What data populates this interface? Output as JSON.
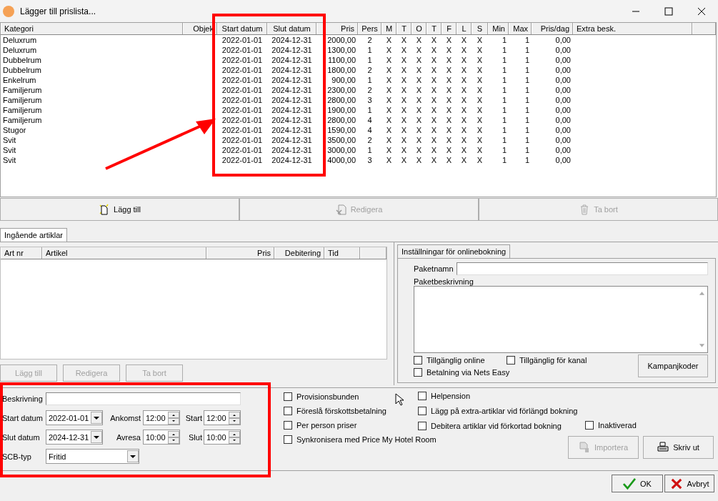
{
  "window": {
    "title": "Lägger till prislista..."
  },
  "price_table": {
    "columns": [
      "Kategori",
      "Objek",
      "Start datum",
      "Slut datum",
      "Pris",
      "Pers",
      "M",
      "T",
      "O",
      "T",
      "F",
      "L",
      "S",
      "Min",
      "Max",
      "Pris/dag",
      "Extra besk."
    ],
    "rows": [
      [
        "Deluxrum",
        "",
        "2022-01-01",
        "2024-12-31",
        "2000,00",
        "2",
        "X",
        "X",
        "X",
        "X",
        "X",
        "X",
        "X",
        "1",
        "1",
        "0,00",
        ""
      ],
      [
        "Deluxrum",
        "",
        "2022-01-01",
        "2024-12-31",
        "1300,00",
        "1",
        "X",
        "X",
        "X",
        "X",
        "X",
        "X",
        "X",
        "1",
        "1",
        "0,00",
        ""
      ],
      [
        "Dubbelrum",
        "",
        "2022-01-01",
        "2024-12-31",
        "1100,00",
        "1",
        "X",
        "X",
        "X",
        "X",
        "X",
        "X",
        "X",
        "1",
        "1",
        "0,00",
        ""
      ],
      [
        "Dubbelrum",
        "",
        "2022-01-01",
        "2024-12-31",
        "1800,00",
        "2",
        "X",
        "X",
        "X",
        "X",
        "X",
        "X",
        "X",
        "1",
        "1",
        "0,00",
        ""
      ],
      [
        "Enkelrum",
        "",
        "2022-01-01",
        "2024-12-31",
        "900,00",
        "1",
        "X",
        "X",
        "X",
        "X",
        "X",
        "X",
        "X",
        "1",
        "1",
        "0,00",
        ""
      ],
      [
        "Familjerum",
        "",
        "2022-01-01",
        "2024-12-31",
        "2300,00",
        "2",
        "X",
        "X",
        "X",
        "X",
        "X",
        "X",
        "X",
        "1",
        "1",
        "0,00",
        ""
      ],
      [
        "Familjerum",
        "",
        "2022-01-01",
        "2024-12-31",
        "2800,00",
        "3",
        "X",
        "X",
        "X",
        "X",
        "X",
        "X",
        "X",
        "1",
        "1",
        "0,00",
        ""
      ],
      [
        "Familjerum",
        "",
        "2022-01-01",
        "2024-12-31",
        "1900,00",
        "1",
        "X",
        "X",
        "X",
        "X",
        "X",
        "X",
        "X",
        "1",
        "1",
        "0,00",
        ""
      ],
      [
        "Familjerum",
        "",
        "2022-01-01",
        "2024-12-31",
        "2800,00",
        "4",
        "X",
        "X",
        "X",
        "X",
        "X",
        "X",
        "X",
        "1",
        "1",
        "0,00",
        ""
      ],
      [
        "Stugor",
        "",
        "2022-01-01",
        "2024-12-31",
        "1590,00",
        "4",
        "X",
        "X",
        "X",
        "X",
        "X",
        "X",
        "X",
        "1",
        "1",
        "0,00",
        ""
      ],
      [
        "Svit",
        "",
        "2022-01-01",
        "2024-12-31",
        "3500,00",
        "2",
        "X",
        "X",
        "X",
        "X",
        "X",
        "X",
        "X",
        "1",
        "1",
        "0,00",
        ""
      ],
      [
        "Svit",
        "",
        "2022-01-01",
        "2024-12-31",
        "3000,00",
        "1",
        "X",
        "X",
        "X",
        "X",
        "X",
        "X",
        "X",
        "1",
        "1",
        "0,00",
        ""
      ],
      [
        "Svit",
        "",
        "2022-01-01",
        "2024-12-31",
        "4000,00",
        "3",
        "X",
        "X",
        "X",
        "X",
        "X",
        "X",
        "X",
        "1",
        "1",
        "0,00",
        ""
      ]
    ]
  },
  "main_buttons": [
    {
      "label": "Lägg till",
      "kind": "new",
      "disabled": false
    },
    {
      "label": "Redigera",
      "kind": "edit",
      "disabled": true
    },
    {
      "label": "Ta bort",
      "kind": "delete",
      "disabled": true
    }
  ],
  "article_tabs": [
    {
      "label": "Ingående artiklar",
      "selected": true
    }
  ],
  "article_table": {
    "columns": [
      "Art nr",
      "Artikel",
      "Pris",
      "Debitering",
      "Tid"
    ]
  },
  "article_buttons": [
    {
      "label": "Lägg till",
      "disabled": true
    },
    {
      "label": "Redigera",
      "disabled": true
    },
    {
      "label": "Ta bort",
      "disabled": true
    }
  ],
  "online_tabs": [
    {
      "label": "Inställningar för onlinebokning",
      "selected": true
    }
  ],
  "package_name": {
    "label": "Paketnamn"
  },
  "package_description": {
    "label": "Paketbeskrivning"
  },
  "online_checks": [
    {
      "label": "Tillgänglig online",
      "checked": false
    },
    {
      "label": "Tillgänglig för kanal",
      "checked": false
    },
    {
      "label": "Betalning via Nets Easy",
      "checked": false
    }
  ],
  "campaign_button": {
    "label": "Kampanjkoder"
  },
  "form": {
    "description": {
      "label": "Beskrivning"
    },
    "start_date": {
      "label": "Start datum",
      "value": "2022-01-01"
    },
    "arrival": {
      "label": "Ankomst",
      "value": "12:00"
    },
    "start": {
      "label": "Start",
      "value": "12:00"
    },
    "end_date": {
      "label": "Slut datum",
      "value": "2024-12-31"
    },
    "departure": {
      "label": "Avresa",
      "value": "10:00"
    },
    "end": {
      "label": "Slut",
      "value": "10:00"
    },
    "scb_type": {
      "label": "SCB-typ",
      "value": "Fritid"
    }
  },
  "options_left": [
    {
      "label": "Provisionsbunden",
      "checked": false
    },
    {
      "label": "Föreslå förskottsbetalning",
      "checked": false
    },
    {
      "label": "Per person priser",
      "checked": false
    },
    {
      "label": "Synkronisera med Price My Hotel Room",
      "checked": false
    }
  ],
  "options_right": [
    {
      "label": "Helpension",
      "checked": false
    },
    {
      "label": "Lägg på extra-artiklar vid förlängd bokning",
      "checked": false
    },
    {
      "label": "Debitera artiklar vid förkortad bokning",
      "checked": false
    }
  ],
  "inactive": {
    "label": "Inaktiverad",
    "checked": false
  },
  "side_buttons": [
    {
      "label": "Importera",
      "kind": "import",
      "disabled": true
    },
    {
      "label": "Skriv ut",
      "kind": "print",
      "disabled": false
    }
  ],
  "dialog_buttons": [
    {
      "label": "OK",
      "kind": "ok"
    },
    {
      "label": "Avbryt",
      "kind": "cancel"
    }
  ]
}
